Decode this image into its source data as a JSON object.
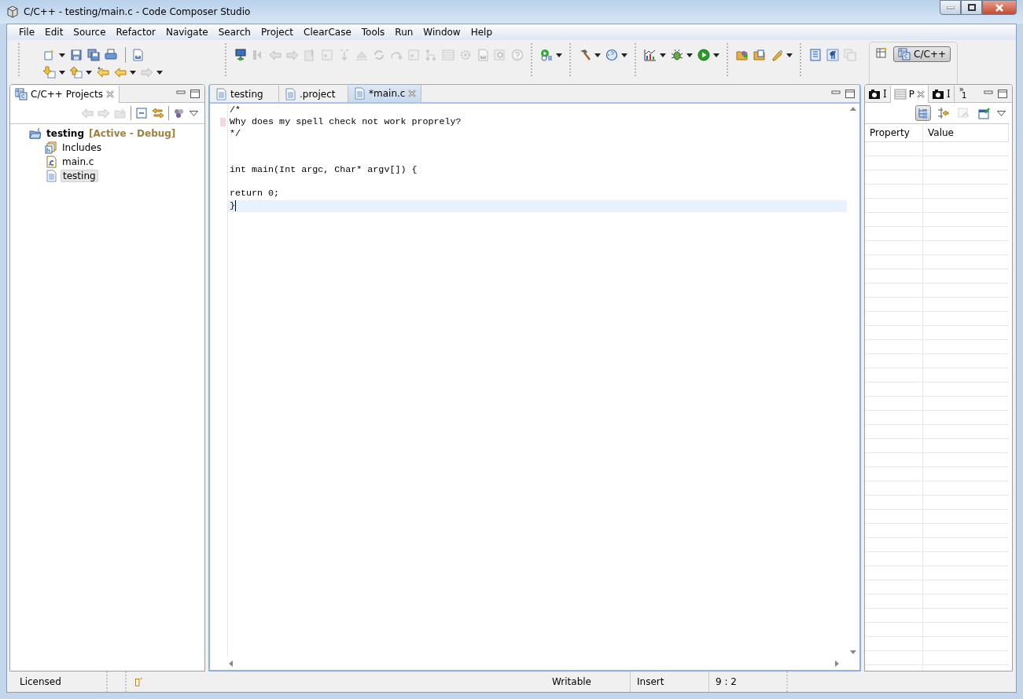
{
  "window": {
    "title": "C/C++ - testing/main.c - Code Composer Studio"
  },
  "menu": [
    {
      "label": "File"
    },
    {
      "label": "Edit"
    },
    {
      "label": "Source"
    },
    {
      "label": "Refactor"
    },
    {
      "label": "Navigate"
    },
    {
      "label": "Search"
    },
    {
      "label": "Project"
    },
    {
      "label": "ClearCase"
    },
    {
      "label": "Tools"
    },
    {
      "label": "Run"
    },
    {
      "label": "Window"
    },
    {
      "label": "Help"
    }
  ],
  "toolbar": {
    "groups": [
      {
        "rows": [
          [
            {
              "kind": "new",
              "dropdown": true,
              "disabled": false
            },
            {
              "kind": "save",
              "dropdown": false,
              "disabled": false
            },
            {
              "kind": "saveall",
              "dropdown": false,
              "disabled": false
            },
            {
              "kind": "print",
              "dropdown": false,
              "disabled": false
            },
            {
              "kind": "sep"
            },
            {
              "kind": "binary",
              "dropdown": false,
              "disabled": false
            }
          ],
          [
            {
              "kind": "nextann",
              "dropdown": true,
              "disabled": false
            },
            {
              "kind": "prevann",
              "dropdown": true,
              "disabled": false
            },
            {
              "kind": "lastedit",
              "dropdown": false,
              "disabled": false
            },
            {
              "kind": "back",
              "dropdown": true,
              "disabled": false
            },
            {
              "kind": "forward",
              "dropdown": true,
              "disabled": true
            }
          ]
        ]
      },
      {
        "rows": [
          [
            {
              "kind": "monitor",
              "dropdown": false,
              "disabled": false
            },
            {
              "kind": "stepin",
              "dropdown": false,
              "disabled": true
            },
            {
              "kind": "back",
              "dropdown": false,
              "disabled": true
            },
            {
              "kind": "forward",
              "dropdown": false,
              "disabled": true
            },
            {
              "kind": "clip",
              "dropdown": false,
              "disabled": true
            },
            {
              "kind": "frame",
              "dropdown": false,
              "disabled": true
            },
            {
              "kind": "split",
              "dropdown": false,
              "disabled": true
            },
            {
              "kind": "erase",
              "dropdown": false,
              "disabled": true
            },
            {
              "kind": "refresh",
              "dropdown": false,
              "disabled": true
            },
            {
              "kind": "hop",
              "dropdown": false,
              "disabled": true
            },
            {
              "kind": "frame",
              "dropdown": false,
              "disabled": true
            },
            {
              "kind": "branch",
              "dropdown": false,
              "disabled": true
            },
            {
              "kind": "table",
              "dropdown": false,
              "disabled": true
            },
            {
              "kind": "gear",
              "dropdown": false,
              "disabled": true
            },
            {
              "kind": "binary",
              "dropdown": false,
              "disabled": true
            },
            {
              "kind": "zoom",
              "dropdown": false,
              "disabled": true
            },
            {
              "kind": "help",
              "dropdown": false,
              "disabled": true
            }
          ]
        ]
      },
      {
        "rows": [
          [
            {
              "kind": "runconfig",
              "dropdown": true,
              "disabled": false
            }
          ]
        ]
      },
      {
        "rows": [
          [
            {
              "kind": "hammer",
              "dropdown": true,
              "disabled": false
            },
            {
              "kind": "dial",
              "dropdown": true,
              "disabled": false
            }
          ]
        ]
      },
      {
        "rows": [
          [
            {
              "kind": "chart",
              "dropdown": true,
              "disabled": false
            },
            {
              "kind": "bug",
              "dropdown": true,
              "disabled": false
            },
            {
              "kind": "play",
              "dropdown": true,
              "disabled": false
            }
          ]
        ]
      },
      {
        "rows": [
          [
            {
              "kind": "folder",
              "dropdown": false,
              "disabled": false
            },
            {
              "kind": "folderedit",
              "dropdown": false,
              "disabled": false
            },
            {
              "kind": "pen",
              "dropdown": true,
              "disabled": false
            }
          ]
        ]
      },
      {
        "rows": [
          [
            {
              "kind": "page",
              "dropdown": false,
              "disabled": false
            },
            {
              "kind": "pilcrow",
              "dropdown": false,
              "disabled": false
            },
            {
              "kind": "copy",
              "dropdown": false,
              "disabled": true
            }
          ]
        ]
      }
    ]
  },
  "perspectives": [
    {
      "label": "C/C++",
      "selected": true
    }
  ],
  "projects_view": {
    "title": "C/C++ Projects",
    "toolbar": [
      {
        "kind": "back",
        "disabled": true
      },
      {
        "kind": "forward",
        "disabled": true
      },
      {
        "kind": "upfolder",
        "disabled": true
      },
      {
        "kind": "sep"
      },
      {
        "kind": "collapse",
        "disabled": false
      },
      {
        "kind": "link",
        "disabled": false
      },
      {
        "kind": "sep"
      },
      {
        "kind": "filter",
        "disabled": false
      }
    ],
    "tree": [
      {
        "label": "testing",
        "config": "[Active - Debug]",
        "kind": "project",
        "selected": false,
        "children": [
          {
            "label": "Includes",
            "kind": "includes",
            "selected": false
          },
          {
            "label": "main.c",
            "kind": "cfile",
            "selected": false
          },
          {
            "label": "testing",
            "kind": "file",
            "selected": true
          }
        ]
      }
    ]
  },
  "editor": {
    "tabs": [
      {
        "label": "testing",
        "selected": false
      },
      {
        "label": ".project",
        "selected": false
      },
      {
        "label": "*main.c",
        "selected": true
      }
    ],
    "lines": [
      {
        "text": "/*",
        "current": false,
        "annotated": false
      },
      {
        "text": "Why does my spell check not work proprely?",
        "current": false,
        "annotated": true
      },
      {
        "text": "*/",
        "current": false,
        "annotated": false
      },
      {
        "current": false,
        "annotated": false
      },
      {
        "current": false,
        "annotated": false
      },
      {
        "text": "int main(Int argc, Char* argv[]) {",
        "current": false,
        "annotated": false
      },
      {
        "current": false,
        "annotated": false
      },
      {
        "text": "return 0;",
        "current": false,
        "annotated": false
      },
      {
        "text": "}",
        "current": true,
        "annotated": false
      }
    ]
  },
  "properties_view": {
    "tabs": [
      {
        "label": "I",
        "kind": "camera",
        "selected": false
      },
      {
        "label": "P",
        "kind": "table",
        "selected": true
      },
      {
        "label": "I",
        "kind": "camera",
        "selected": false
      }
    ],
    "overflow": {
      "symbol": "»",
      "count": "1"
    },
    "toolbar": [
      {
        "kind": "tree",
        "pressed": true,
        "disabled": false
      },
      {
        "kind": "advanced",
        "pressed": false,
        "disabled": false
      },
      {
        "kind": "restore",
        "pressed": false,
        "disabled": true
      },
      {
        "kind": "pin",
        "pressed": false,
        "disabled": false
      }
    ],
    "columns": [
      "Property",
      "Value"
    ]
  },
  "status_bar": {
    "license": "Licensed",
    "mode": "Writable",
    "insert": "Insert",
    "position": "9 : 2"
  }
}
